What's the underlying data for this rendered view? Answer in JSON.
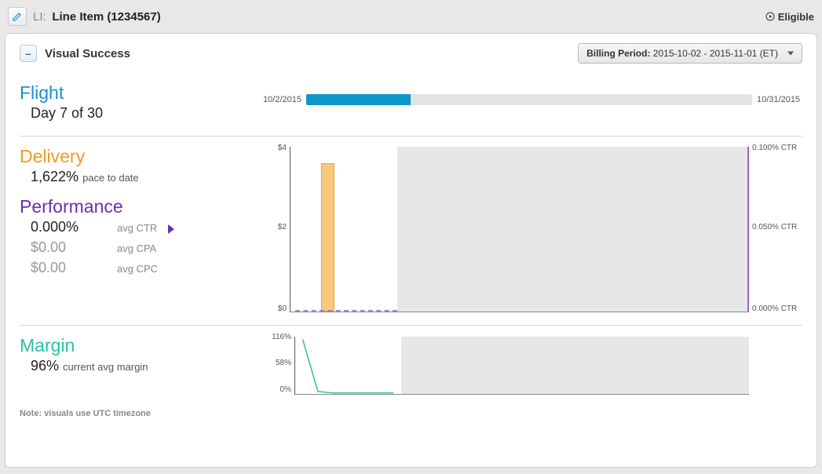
{
  "header": {
    "li_prefix": "LI:",
    "li_name": "Line Item (1234567)",
    "eligible_label": "Eligible"
  },
  "panel": {
    "title": "Visual Success",
    "collapse_symbol": "–",
    "billing_label": "Billing Period:",
    "billing_value": "2015-10-02 - 2015-11-01 (ET)"
  },
  "flight": {
    "title": "Flight",
    "subline": "Day 7 of 30",
    "start_label": "10/2/2015",
    "end_label": "10/31/2015"
  },
  "delivery": {
    "title": "Delivery",
    "value": "1,622%",
    "desc": "pace to date"
  },
  "performance": {
    "title": "Performance",
    "rows": [
      {
        "value": "0.000%",
        "label": "avg CTR",
        "gray": false,
        "expand": true
      },
      {
        "value": "$0.00",
        "label": "avg CPA",
        "gray": true,
        "expand": false
      },
      {
        "value": "$0.00",
        "label": "avg CPC",
        "gray": true,
        "expand": false
      }
    ]
  },
  "margin": {
    "title": "Margin",
    "value": "96%",
    "desc": "current avg margin"
  },
  "note": "Note: visuals use UTC timezone",
  "chart_data": [
    {
      "type": "bar",
      "name": "flight_progress",
      "total_days": 30,
      "elapsed_days": 7,
      "start": "2015-10-02",
      "end": "2015-10-31"
    },
    {
      "type": "bar",
      "name": "delivery_spend",
      "x": [
        "Day1",
        "Day2",
        "Day3",
        "Day4",
        "Day5",
        "Day6",
        "Day7"
      ],
      "values": [
        0,
        0,
        3.6,
        0,
        0,
        0,
        0
      ],
      "ylabel": "$",
      "ylim": [
        0,
        4
      ],
      "yticks": [
        0,
        2,
        4
      ],
      "ytick_labels": [
        "$0",
        "$2",
        "$4"
      ],
      "future_days": 23
    },
    {
      "type": "line",
      "name": "performance_ctr",
      "x": [
        "Day1",
        "Day2",
        "Day3",
        "Day4",
        "Day5",
        "Day6",
        "Day7"
      ],
      "values": [
        0,
        0,
        0,
        0,
        0,
        0,
        0
      ],
      "ylabel": "CTR",
      "ylim": [
        0,
        0.1
      ],
      "yticks": [
        0,
        0.05,
        0.1
      ],
      "ytick_labels": [
        "0.000% CTR",
        "0.050% CTR",
        "0.100% CTR"
      ]
    },
    {
      "type": "line",
      "name": "margin_pct",
      "x": [
        "Day1",
        "Day2",
        "Day3",
        "Day4",
        "Day5",
        "Day6",
        "Day7"
      ],
      "values": [
        110,
        5,
        2,
        2,
        2,
        2,
        2
      ],
      "ylabel": "%",
      "ylim": [
        0,
        116
      ],
      "yticks": [
        0,
        58,
        116
      ],
      "ytick_labels": [
        "0%",
        "58%",
        "116%"
      ],
      "future_days": 23
    }
  ]
}
